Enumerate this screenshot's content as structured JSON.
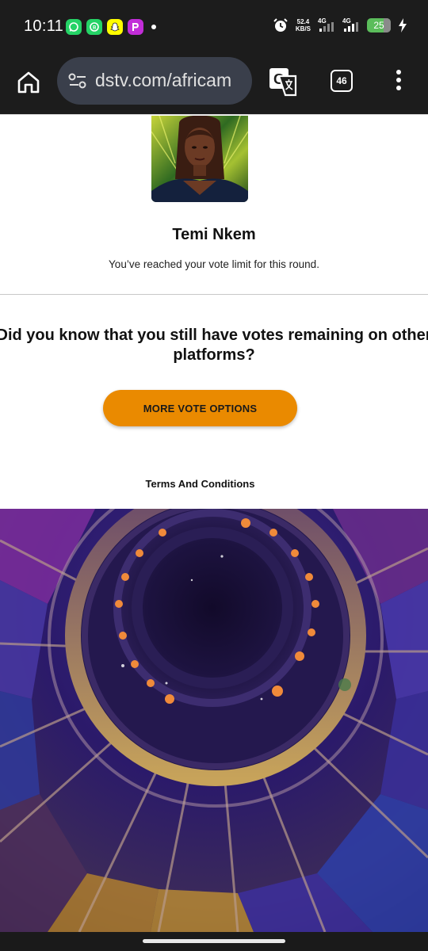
{
  "status_bar": {
    "time": "10:11",
    "app_icons": [
      "whatsapp-icon",
      "whatsapp-business-icon",
      "snapchat-icon",
      "picsart-icon"
    ],
    "net_speed_value": "52.4",
    "net_speed_unit": "KB/S",
    "sim1_label": "4G",
    "sim2_label": "4G",
    "battery_level": "25"
  },
  "toolbar": {
    "url": "dstv.com/africam",
    "tab_count": "46"
  },
  "contestant": {
    "name": "Temi Nkem",
    "status_message": "You’ve reached your vote limit for this round."
  },
  "promo": {
    "question": "Did you know that you still have votes remaining on other platforms?",
    "question_line1": "Did you know that you still have votes remaining on other",
    "question_line2": "platforms?",
    "button_label": "MORE VOTE OPTIONS"
  },
  "footer": {
    "terms_link": "Terms And Conditions"
  },
  "colors": {
    "accent_button": "#ea8a00",
    "chrome_dark": "#1c1c1c",
    "url_bar": "#3a3f4b",
    "battery_green": "#5bbd5b"
  }
}
